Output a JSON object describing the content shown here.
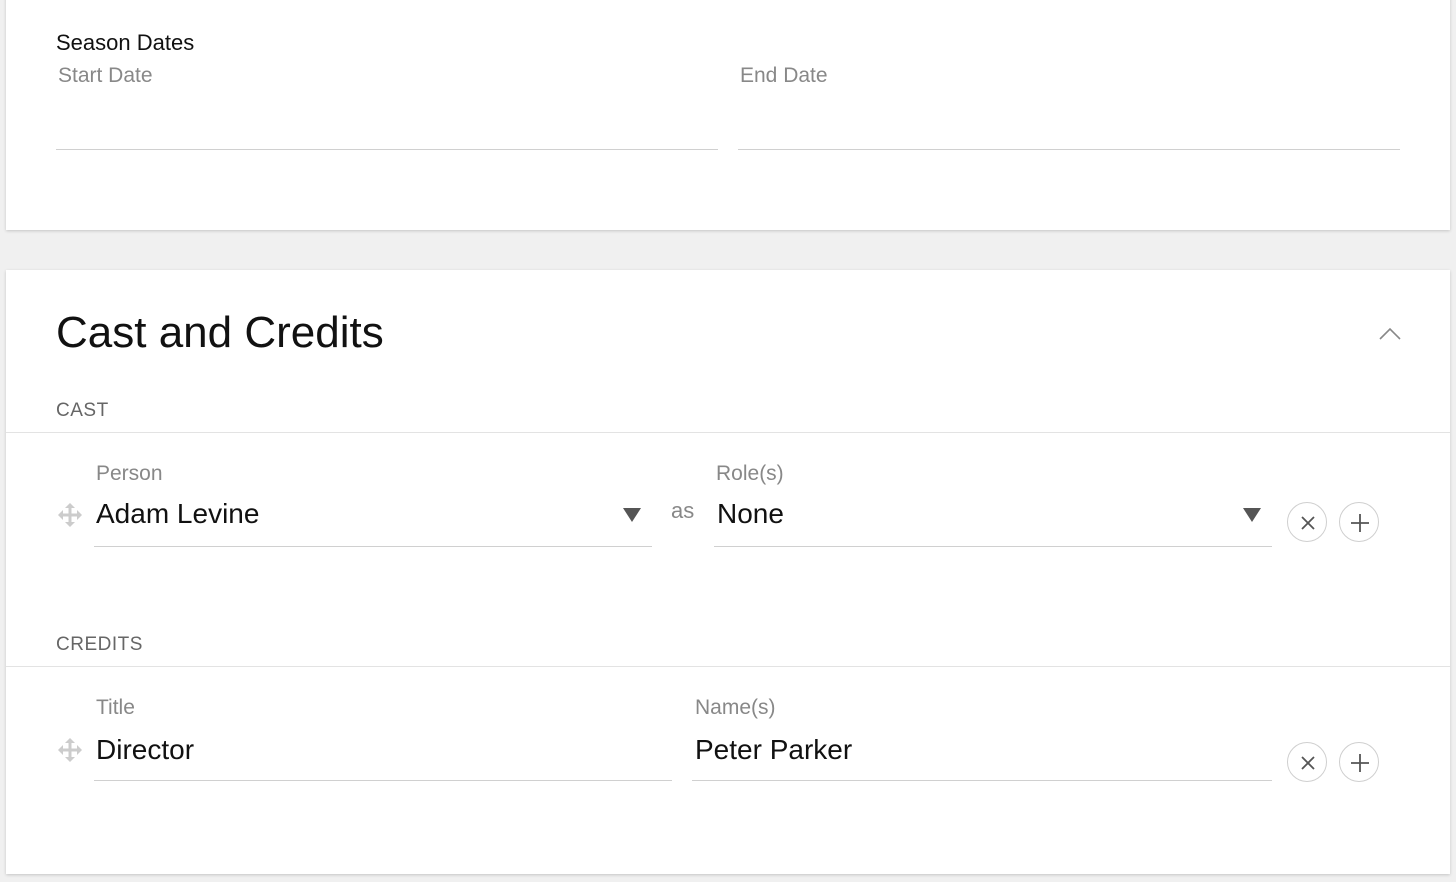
{
  "season_dates": {
    "heading": "Season Dates",
    "start_label": "Start Date",
    "start_value": "",
    "end_label": "End Date",
    "end_value": ""
  },
  "cast_credits": {
    "title": "Cast and Credits",
    "collapse_icon": "chevron-up-icon",
    "cast": {
      "heading": "CAST",
      "row": {
        "person_label": "Person",
        "person_value": "Adam Levine",
        "as_text": "as",
        "roles_label": "Role(s)",
        "roles_value": "None"
      }
    },
    "credits": {
      "heading": "CREDITS",
      "row": {
        "title_label": "Title",
        "title_value": "Director",
        "names_label": "Name(s)",
        "names_value": "Peter Parker"
      }
    }
  },
  "colors": {
    "background": "#f0f0f0",
    "card": "#ffffff",
    "line": "#d0d0d0",
    "label": "#888888"
  }
}
